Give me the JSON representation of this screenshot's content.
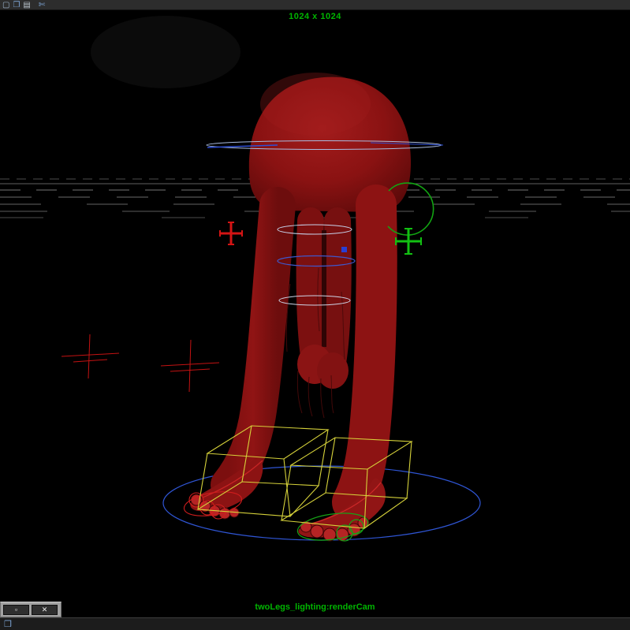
{
  "titlebar": {
    "icons": [
      {
        "name": "new-window-icon",
        "glyph": "▢"
      },
      {
        "name": "snapshot-icon",
        "glyph": "❐"
      },
      {
        "name": "layout-icon",
        "glyph": "▤"
      },
      {
        "name": "cut-icon",
        "glyph": "✄"
      }
    ]
  },
  "viewport": {
    "resolution_label": "1024 x 1024",
    "camera_label": "twoLegs_lighting:renderCam",
    "label_color": "#00b400",
    "background": "#000000"
  },
  "scene_colors": {
    "body_red": "#8e1414",
    "selection_yellow": "#d6d23a",
    "ground_circle_blue": "#2f55d4",
    "manipulator_red": "#d41414",
    "manipulator_green": "#12c012",
    "curve_light_blue": "#a9bce0",
    "grid_gray": "#9a9a9a"
  },
  "window_controls": {
    "restore_glyph": "▫",
    "close_glyph": "✕"
  },
  "taskbar": {
    "window_icon_glyph": "❒"
  }
}
